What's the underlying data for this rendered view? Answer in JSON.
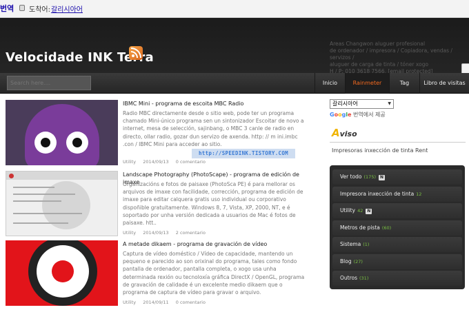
{
  "translate_bar": {
    "brand": "번역",
    "label": "도착어:",
    "language_link": "갈리시아어"
  },
  "header": {
    "site_title": "Velocidade INK Terra",
    "info_lines": [
      "Areas Changwon aluguer profesional",
      "de ordenador / impresora / Copiadora, vendas / servizos /",
      "aluguer de carga de tinta / tóner xogo",
      "H / P: 010 3618 7566, [email protected]"
    ]
  },
  "nav": {
    "search_placeholder": "Search here....",
    "tabs": [
      "Inicio",
      "Rainmeter",
      "Tag",
      "Libro de visitas"
    ],
    "active_tab": "Rainmeter"
  },
  "posts": [
    {
      "title": "IBMC Mini - programa de escoita MBC Radio",
      "body": "Radio MBC directamente desde o sitio web, pode ter un programa chamado Mini-único programa sen un sintonizador Escoitar de novo a internet, mesa de selección, sajinbang, o MBC 3 canle de radio en directo, ollar radio, gozar dun servizo de axenda. http: // m ini.imbc .con / IBMC Mini para acceder ao sitio.",
      "category": "Utility",
      "date": "2014/09/13",
      "comments": "0 comentario"
    },
    {
      "title": "Landscape Photography (PhotoScape) - programa de edición de imaxe",
      "body": "Organizacións e fotos de paisaxe (PhotoSca PE) é para mellorar os arquivos de imaxe con facilidade, corrección, programa de edición de imaxe para editar calquera gratis uso individual ou corporativo dispoñible gratuitamente. Windows 8, 7, Vista, XP, 2000, NT, e é soportado por unha versión dedicada a usuarios de Mac é fotos de paisaxe. htt..",
      "category": "Utility",
      "date": "2014/09/13",
      "comments": "2 comentario"
    },
    {
      "title": "A metade dikaem - programa de gravación de vídeo",
      "body": "Captura de vídeo doméstico / Vídeo de capacidade, mantendo un pequeno e parecido ao son orixinal do programa, tales como fondo pantalla de ordenador, pantalla completa, o xogo usa unha determinada rexión ou tecnoloxía gráfica DirectX / OpenGL, programa de gravación de calidade é un excelente medio dikaem que o programa de captura de vídeo para gravar o arquivo.",
      "category": "Utility",
      "date": "2014/09/11",
      "comments": "0 comentario"
    }
  ],
  "watermark": "http://SPEEDINK.TISTORY.COM",
  "sidebar": {
    "lang_select": "갈리시아어",
    "google_word": "Google",
    "google_suffix": "번역에서 제공",
    "aviso_icon": "A",
    "aviso_rest": "viso",
    "notice_text": "Impresoras inxección de tinta Rent",
    "categories": [
      {
        "label": "Ver todo",
        "count": "(175)",
        "badge": "N"
      },
      {
        "label": "Impresora inxección de tinta",
        "count": "12",
        "badge": ""
      },
      {
        "label": "Utility",
        "count": "42",
        "badge": "N"
      },
      {
        "label": "Metros de pista",
        "count": "(60)",
        "badge": ""
      },
      {
        "label": "Sistema",
        "count": "(1)",
        "badge": ""
      },
      {
        "label": "Blog",
        "count": "(27)",
        "badge": ""
      },
      {
        "label": "Outros",
        "count": "(31)",
        "badge": ""
      }
    ]
  },
  "colors": {
    "accent": "#f46a20",
    "count_green": "#7ac143",
    "header_bg": "#1b1b1b"
  }
}
